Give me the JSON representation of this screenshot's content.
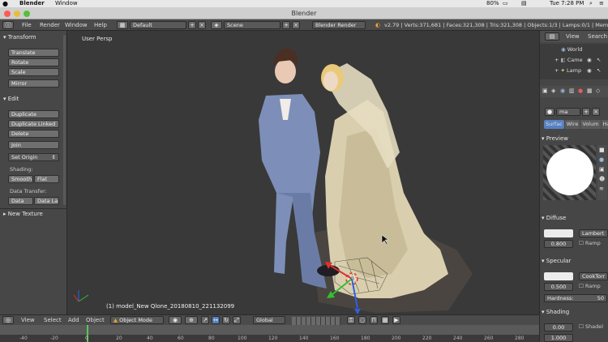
{
  "mac": {
    "app": "Blender",
    "menu": "Window",
    "battery": "80%",
    "time": "Tue 7:28 PM"
  },
  "window": {
    "title": "Blender"
  },
  "info": {
    "menus": [
      "File",
      "Render",
      "Window",
      "Help"
    ],
    "layout": "Default",
    "scene": "Scene",
    "engine": "Blender Render",
    "stats": "v2.79 | Verts:371,681 | Faces:321,308 | Tris:321,308 | Objects:1/3 | Lamps:0/1 | Mem:1."
  },
  "toolshelf": {
    "transform_header": "Transform",
    "translate": "Translate",
    "rotate": "Rotate",
    "scale": "Scale",
    "mirror": "Mirror",
    "edit_header": "Edit",
    "duplicate": "Duplicate",
    "duplicate_linked": "Duplicate Linked",
    "delete": "Delete",
    "join": "Join",
    "set_origin": "Set Origin",
    "shading_label": "Shading:",
    "smooth": "Smooth",
    "flat": "Flat",
    "data_transfer_label": "Data Transfer:",
    "data": "Data",
    "data_layout": "Data La",
    "new_texture": "New Texture"
  },
  "viewport": {
    "view_label": "User Persp",
    "object_label": "(1) model_New Qlone_20180810_221132099"
  },
  "header": {
    "menus": [
      "View",
      "Select",
      "Add",
      "Object"
    ],
    "mode": "Object Mode",
    "orientation": "Global"
  },
  "timeline": {
    "ticks": [
      "-40",
      "-20",
      "0",
      "20",
      "40",
      "60",
      "80",
      "100",
      "120",
      "140",
      "160",
      "180",
      "200",
      "220",
      "240",
      "260",
      "280"
    ]
  },
  "outliner": {
    "view": "View",
    "search": "Search",
    "items": [
      "World",
      "Came",
      "Lamp"
    ]
  },
  "properties": {
    "material_name": "ma",
    "tabs": [
      "Surfac",
      "Wire",
      "Volum",
      "Halo"
    ],
    "preview": "Preview",
    "diffuse": "Diffuse",
    "diffuse_shader": "Lambert",
    "diffuse_intensity": "0.800",
    "ramp": "Ramp",
    "specular": "Specular",
    "specular_shader": "CookTorr",
    "specular_intensity": "0.500",
    "ramp2": "Ramp",
    "hardness": "Hardness:",
    "hardness_value": "50",
    "shading": "Shading",
    "emit_value": "0.00",
    "shadeless": "Shadel",
    "ambient_value": "1.000"
  },
  "colors": {
    "accent": "#5680c2",
    "panel": "#474747",
    "viewport": "#393939"
  }
}
